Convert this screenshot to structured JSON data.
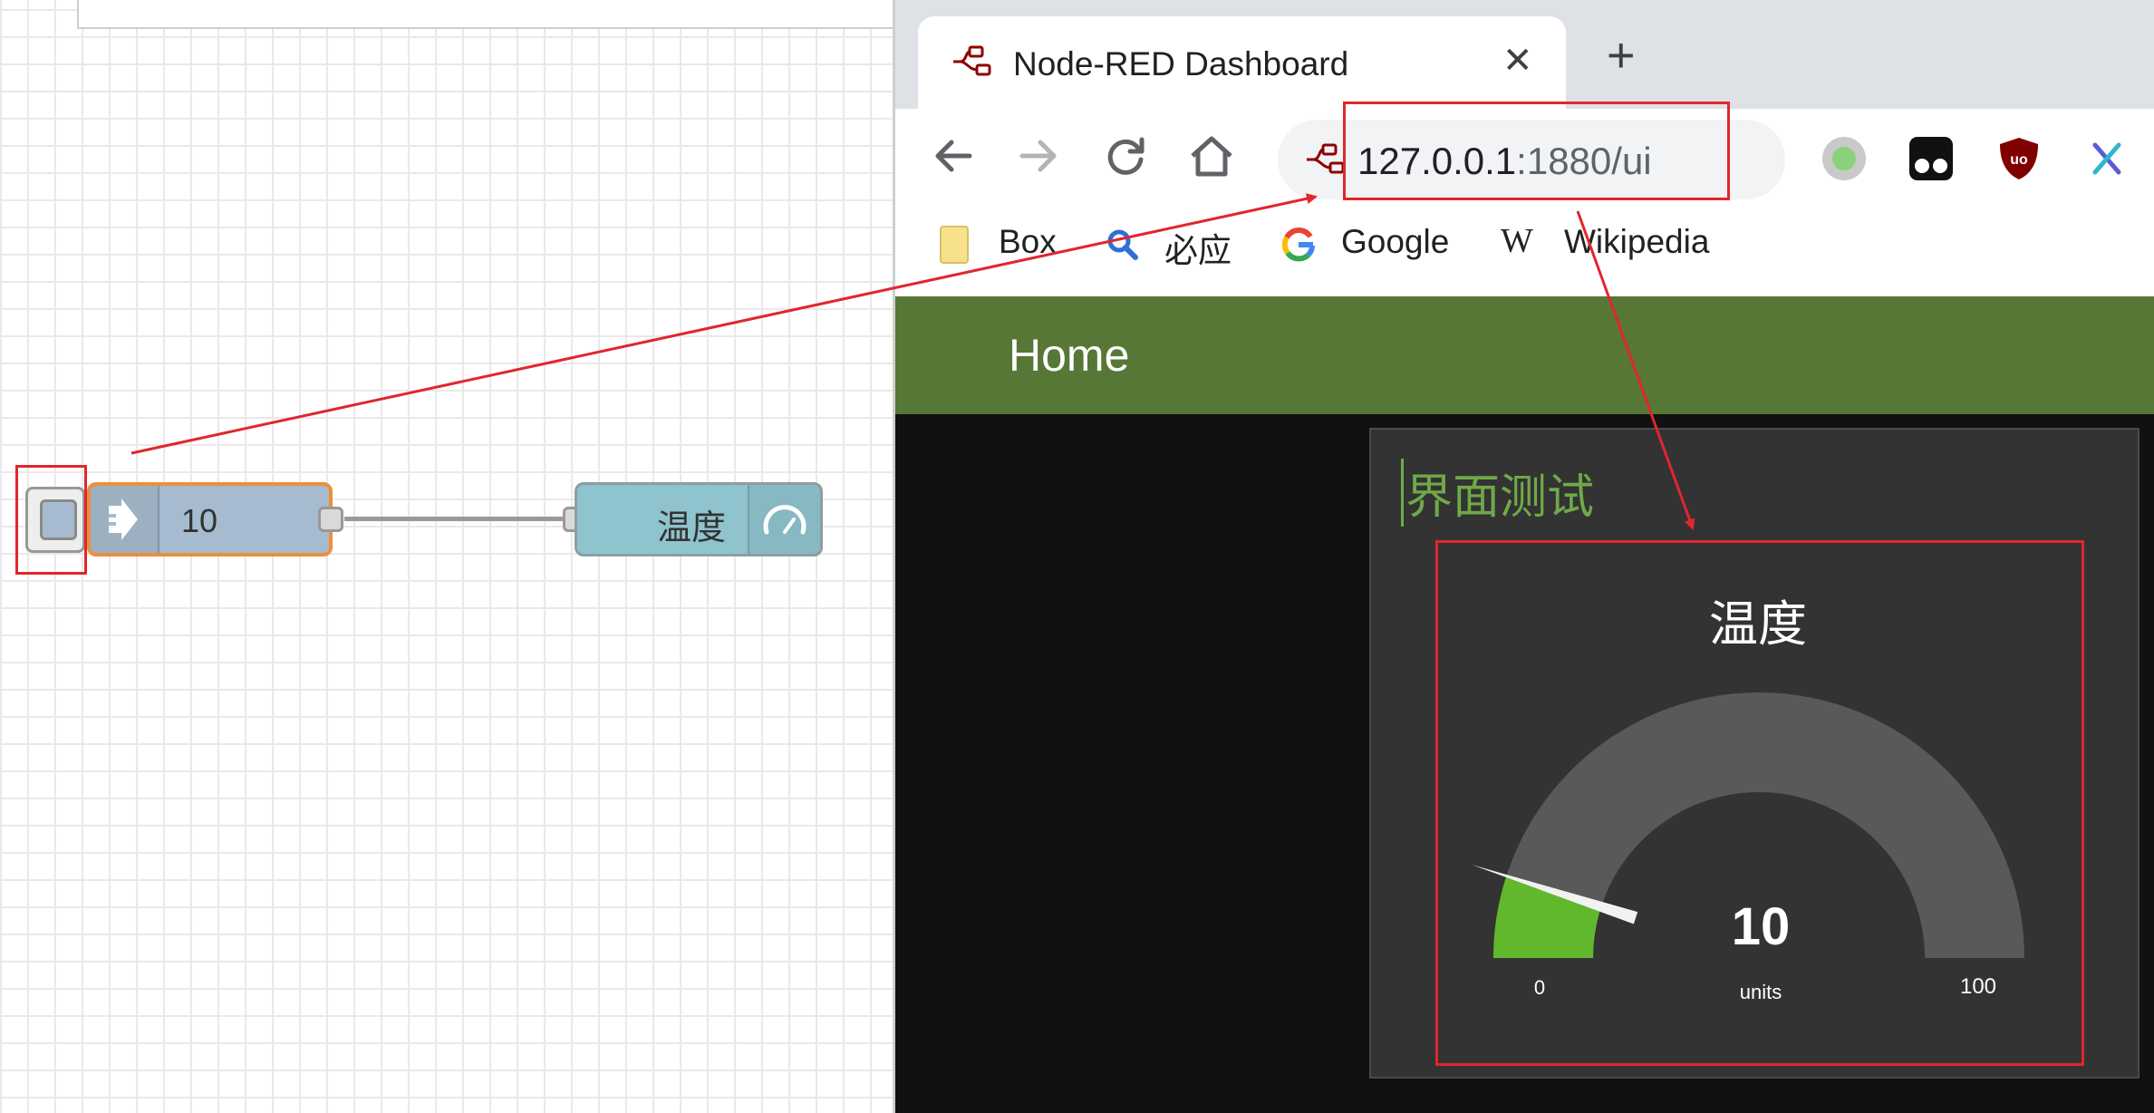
{
  "editor": {
    "inject_node": {
      "label": "10"
    },
    "gauge_node": {
      "label": "温度"
    }
  },
  "browser": {
    "tab": {
      "title": "Node-RED Dashboard",
      "close_symbol": "✕",
      "new_tab_symbol": "+"
    },
    "url": {
      "host": "127.0.0.1",
      "rest": ":1880/ui"
    },
    "bookmarks": [
      {
        "label": "Box",
        "icon": "folder-icon"
      },
      {
        "label": "必应",
        "icon": "bing-search-icon"
      },
      {
        "label": "Google",
        "icon": "google-icon"
      },
      {
        "label": "Wikipedia",
        "icon": "wikipedia-icon"
      }
    ],
    "extensions": [
      "circle-extension-icon",
      "tampermonkey-icon",
      "ublock-origin-icon",
      "x-extension-icon"
    ]
  },
  "dashboard": {
    "header": {
      "title": "Home"
    },
    "group": {
      "title": "界面测试"
    },
    "gauge": {
      "title": "温度",
      "value": "10",
      "units": "units",
      "min": "0",
      "max": "100",
      "fill_color": "#62b82d",
      "track_color": "#595959"
    }
  },
  "colors": {
    "dashboard_header": "#577736",
    "group_title": "#6fa948",
    "inject_node_fill": "#a6bbcf",
    "inject_node_selected_border": "#e8913b",
    "gauge_node_fill": "#8fc3cd",
    "annotation_red": "#e1262d"
  }
}
